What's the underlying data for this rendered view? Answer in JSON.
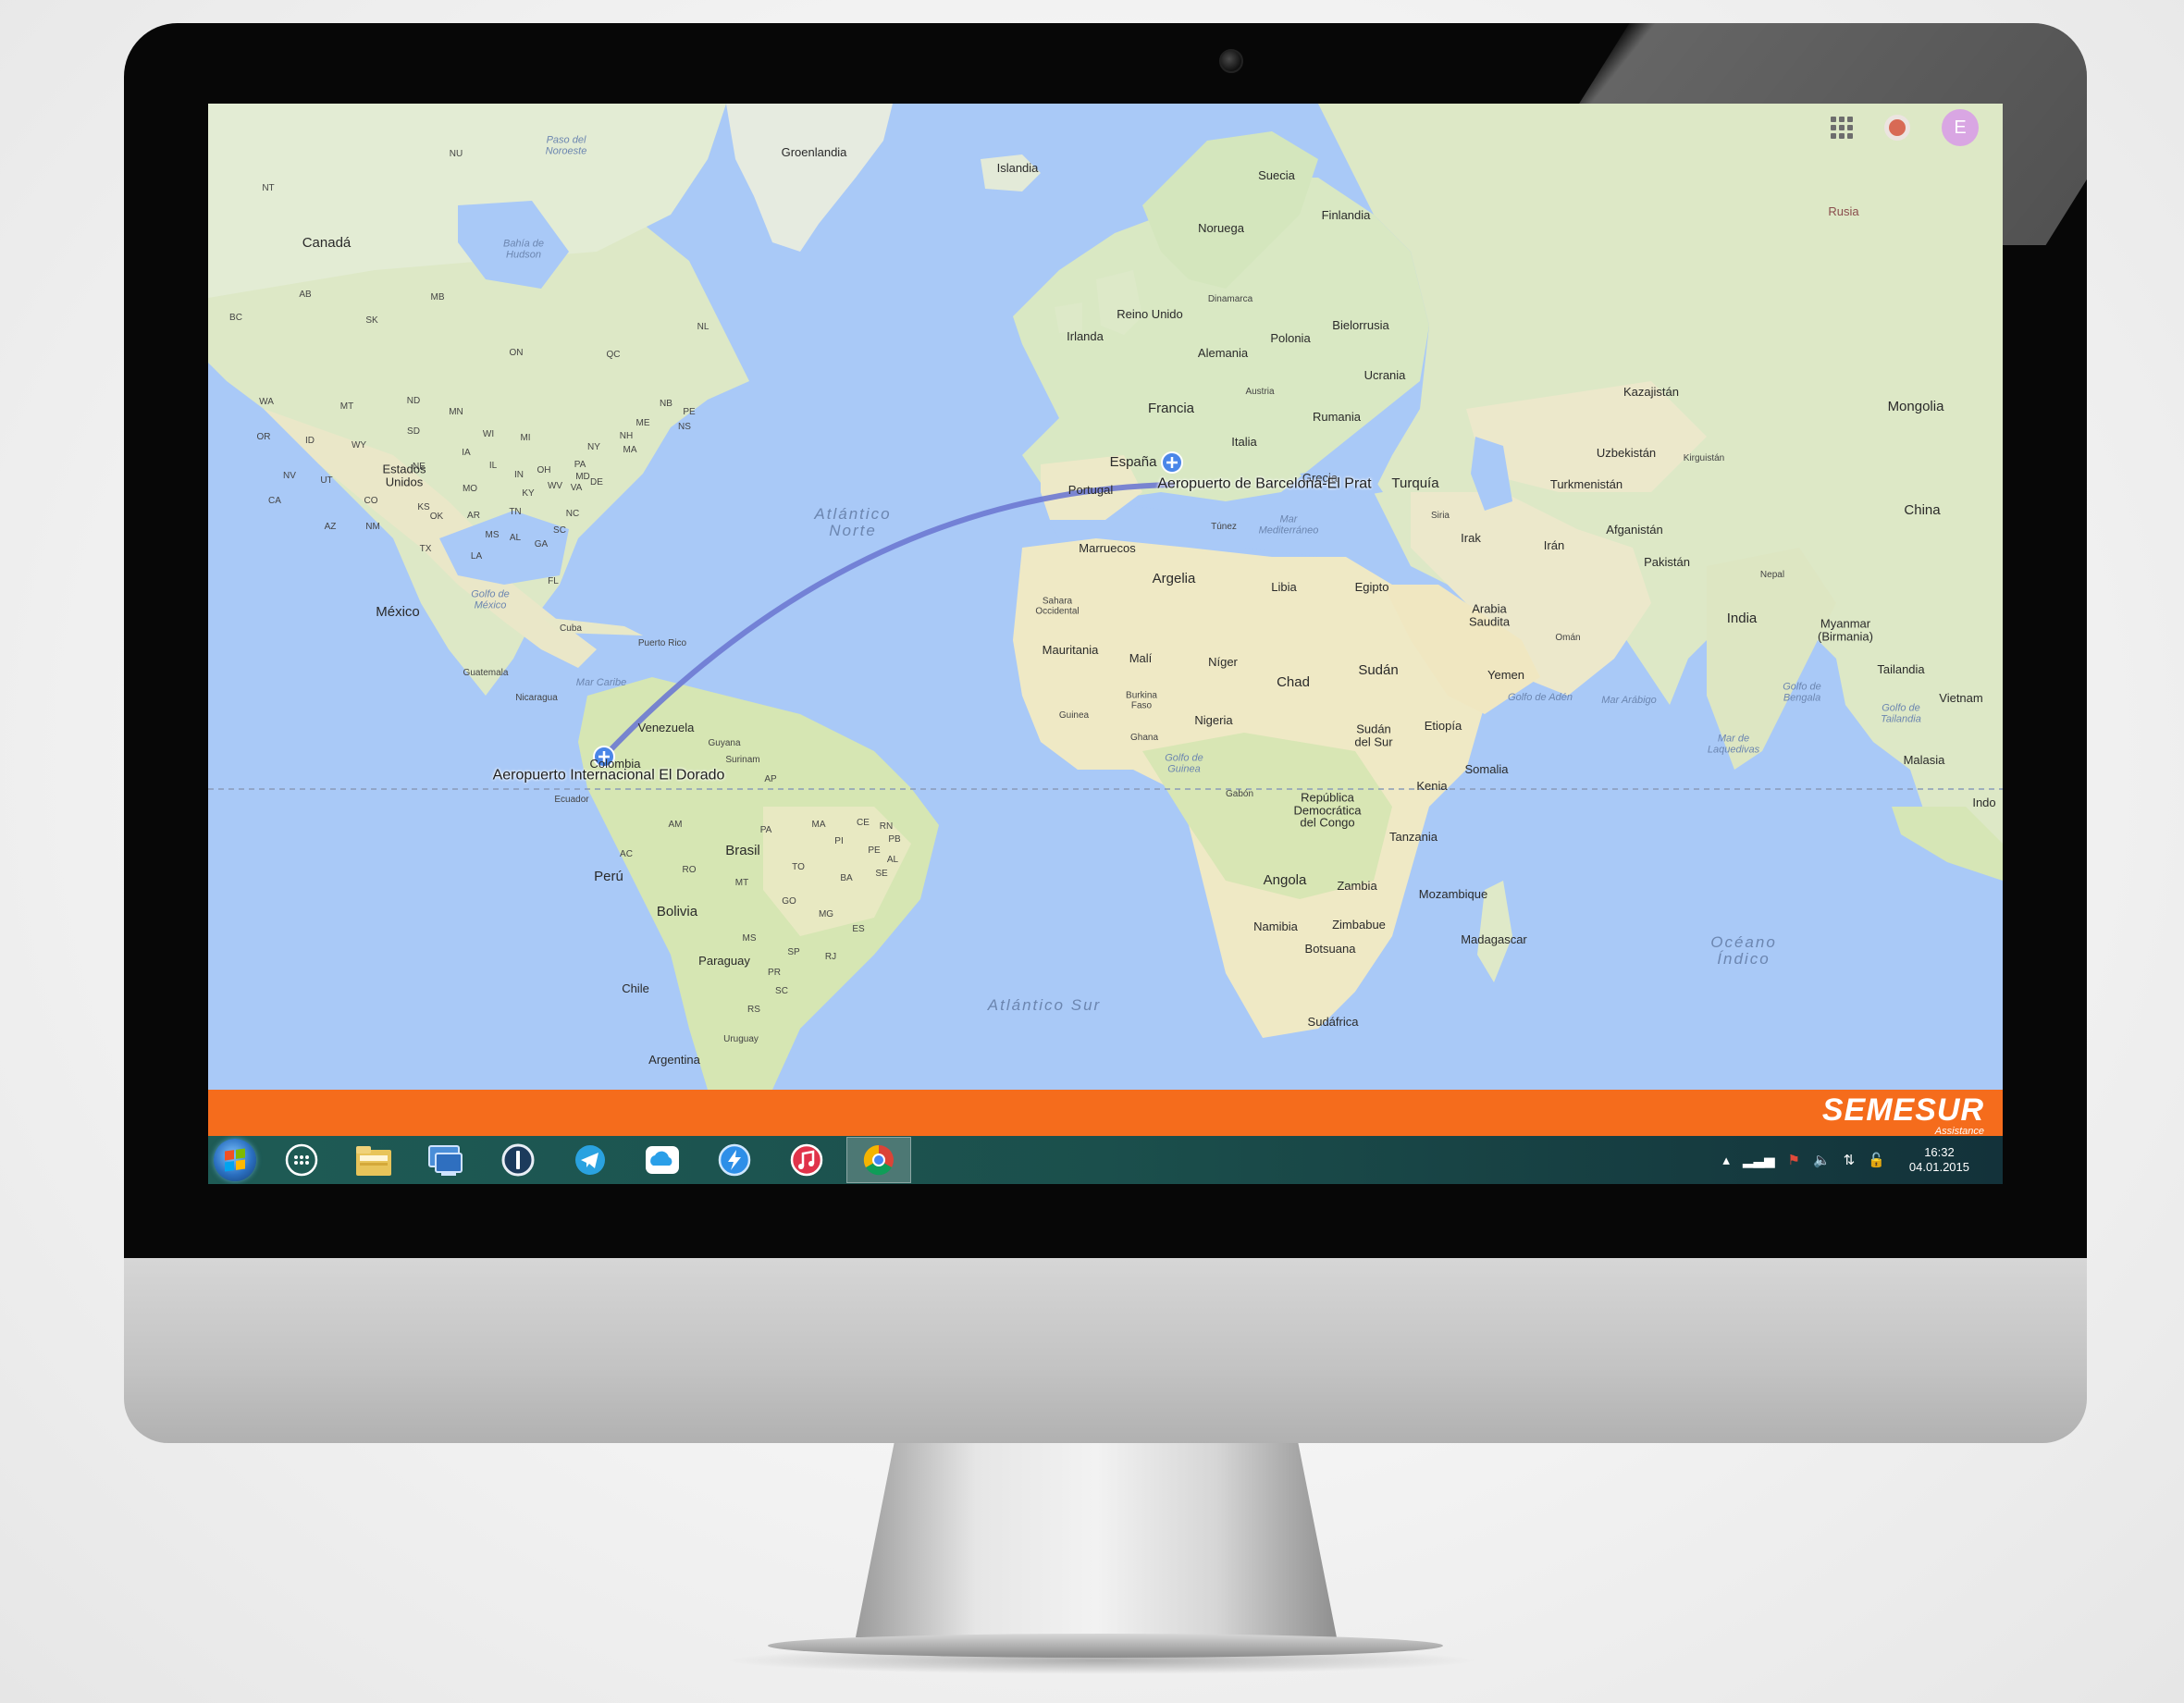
{
  "map": {
    "labels": {
      "groenlandia": "Groenlandia",
      "islandia": "Islandia",
      "canada": "Canadá",
      "estados_unidos": "Estados\nUnidos",
      "mexico": "México",
      "cuba": "Cuba",
      "puerto_rico": "Puerto Rico",
      "guatemala": "Guatemala",
      "nicaragua": "Nicaragua",
      "venezuela": "Venezuela",
      "colombia": "Colombia",
      "guyana": "Guyana",
      "surinam": "Surinam",
      "ecuador": "Ecuador",
      "peru": "Perú",
      "brasil": "Brasil",
      "bolivia": "Bolivia",
      "paraguay": "Paraguay",
      "chile": "Chile",
      "uruguay": "Uruguay",
      "argentina": "Argentina",
      "suecia": "Suecia",
      "noruega": "Noruega",
      "finlandia": "Finlandia",
      "dinamarca": "Dinamarca",
      "reino_unido": "Reino Unido",
      "irlanda": "Irlanda",
      "bielorrusia": "Bielorrusia",
      "polonia": "Polonia",
      "alemania": "Alemania",
      "ucrania": "Ucrania",
      "austria": "Austria",
      "francia": "Francia",
      "rumania": "Rumania",
      "italia": "Italia",
      "espana": "España",
      "portugal": "Portugal",
      "grecia": "Grecia",
      "turquia": "Turquía",
      "rusia": "Rusia",
      "kazajistan": "Kazajistán",
      "mongolia": "Mongolia",
      "uzbekistan": "Uzbekistán",
      "kirguistan": "Kirguistán",
      "turkmenistan": "Turkmenistán",
      "china": "China",
      "afganistan": "Afganistán",
      "pakistan": "Pakistán",
      "nepal": "Nepal",
      "india": "India",
      "myanmar": "Myanmar\n(Birmania)",
      "tailandia": "Tailandia",
      "vietnam": "Vietnam",
      "malasia": "Malasia",
      "indo": "Indo",
      "siria": "Siria",
      "irak": "Irak",
      "iran": "Irán",
      "arabia_saudita": "Arabia\nSaudita",
      "oman": "Omán",
      "yemen": "Yemen",
      "marruecos": "Marruecos",
      "tunez": "Túnez",
      "argelia": "Argelia",
      "libia": "Libia",
      "egipto": "Egipto",
      "sahara": "Sahara\nOccidental",
      "mauritania": "Mauritania",
      "mali": "Malí",
      "niger": "Níger",
      "chad": "Chad",
      "sudan": "Sudán",
      "burkina": "Burkina\nFaso",
      "guinea": "Guinea",
      "ghana": "Ghana",
      "nigeria": "Nigeria",
      "sudan_sur": "Sudán\ndel Sur",
      "etiopia": "Etiopía",
      "somalia": "Somalia",
      "kenia": "Kenia",
      "gabon": "Gabón",
      "rdc": "República\nDemocrática\ndel Congo",
      "tanzania": "Tanzania",
      "angola": "Angola",
      "zambia": "Zambia",
      "mozambique": "Mozambique",
      "namibia": "Namibia",
      "zimbabue": "Zimbabue",
      "botsuana": "Botsuana",
      "madagascar": "Madagascar",
      "sudafrica": "Sudáfrica",
      "atlantico_norte": "Atlántico\nNorte",
      "atlantico_sur": "Atlántico Sur",
      "oceano_indico": "Océano\nÍndico",
      "bahia_hudson": "Bahía de\nHudson",
      "golfo_mexico": "Golfo de\nMéxico",
      "mar_caribe": "Mar Caribe",
      "mar_mediterraneo": "Mar\nMediterráneo",
      "golfo_guinea": "Golfo de\nGuinea",
      "golfo_aden": "Golfo de Adén",
      "mar_arabigo": "Mar Arábigo",
      "golfo_bengala": "Golfo de\nBengala",
      "golfo_tailandia": "Golfo de\nTailandia",
      "mar_laquedivas": "Mar de\nLaquedivas",
      "paso_noroeste": "Paso del\nNoroeste",
      "nu": "NU",
      "nt": "NT",
      "ab": "AB",
      "bc": "BC",
      "sk": "SK",
      "mb": "MB",
      "on": "ON",
      "qc": "QC",
      "nl": "NL",
      "wa": "WA",
      "mt": "MT",
      "nd": "ND",
      "mn": "MN",
      "or": "OR",
      "id": "ID",
      "wy": "WY",
      "sd": "SD",
      "wi": "WI",
      "mi": "MI",
      "ny": "NY",
      "nv": "NV",
      "ut": "UT",
      "co": "CO",
      "ks": "KS",
      "mo": "MO",
      "ky": "KY",
      "ca": "CA",
      "az": "AZ",
      "nm": "NM",
      "ok": "OK",
      "tx": "TX",
      "ar": "AR",
      "ms": "MS",
      "al": "AL",
      "ga": "GA",
      "la": "LA",
      "fl": "FL",
      "tn": "TN",
      "nc": "NC",
      "sc": "SC",
      "va": "VA",
      "wv": "WV",
      "oh": "OH",
      "pa": "PA",
      "in": "IN",
      "il": "IL",
      "ia": "IA",
      "ne": "NE",
      "md": "MD",
      "de": "DE",
      "me": "ME",
      "nh": "NH",
      "ma": "MA",
      "ns": "NS",
      "nb": "NB",
      "pe": "PE",
      "am": "AM",
      "pa_br": "PA",
      "ma_br": "MA",
      "ce": "CE",
      "rn": "RN",
      "pb": "PB",
      "pe_br": "PE",
      "pi": "PI",
      "al_br": "AL",
      "se": "SE",
      "to": "TO",
      "ba": "BA",
      "ac": "AC",
      "ro": "RO",
      "mt_br": "MT",
      "go": "GO",
      "mg": "MG",
      "es": "ES",
      "ms_br": "MS",
      "sp": "SP",
      "rj": "RJ",
      "pr": "PR",
      "sc_br": "SC",
      "rs": "RS",
      "ap": "AP"
    },
    "airports": {
      "origin": "Aeropuerto Internacional El Dorado",
      "destination": "Aeropuerto de Barcelona-El Prat"
    },
    "colors": {
      "water": "#a9c9f7",
      "land": "#e9eed9",
      "route": "#6d79d1",
      "brand": "#f56c1c"
    },
    "topbar": {
      "apps_icon": "apps-grid-icon",
      "notifications_icon": "notifications-icon",
      "account_initial": "E"
    }
  },
  "brand": {
    "name": "SEMESUR",
    "subtitle": "Assistance"
  },
  "taskbar": {
    "apps": [
      {
        "name": "app-launcher-icon",
        "glyph": "⋯"
      },
      {
        "name": "file-explorer-icon",
        "glyph": "▤"
      },
      {
        "name": "remote-desktop-icon",
        "glyph": "▣"
      },
      {
        "name": "password-manager-icon",
        "glyph": "①"
      },
      {
        "name": "telegram-icon",
        "glyph": "➤"
      },
      {
        "name": "cloud-drive-icon",
        "glyph": "☁"
      },
      {
        "name": "messenger-icon",
        "glyph": "⚡"
      },
      {
        "name": "itunes-icon",
        "glyph": "♫"
      },
      {
        "name": "chrome-icon",
        "glyph": "◉"
      }
    ],
    "tray": {
      "time": "16:32",
      "date": "04.01.2015"
    }
  }
}
